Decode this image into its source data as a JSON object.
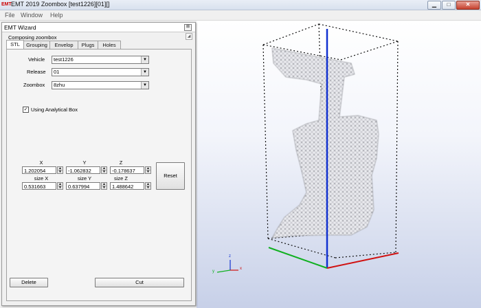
{
  "window": {
    "title": "EMT 2019 Zoombox [test1226][01][]",
    "app_icon_text": "EMT",
    "minimize_glyph": "▁",
    "maximize_glyph": "□",
    "close_glyph": "✕"
  },
  "menu": {
    "items": [
      "File",
      "Window",
      "Help"
    ]
  },
  "wizard": {
    "title": "EMT Wizard",
    "close_glyph": "⊠",
    "grip_glyph": "◢",
    "group_label": "Composing zoombox",
    "tabs": [
      {
        "label": "STL",
        "active": true
      },
      {
        "label": "Grouping",
        "active": false
      },
      {
        "label": "Envelop",
        "active": false
      },
      {
        "label": "Plugs",
        "active": false
      },
      {
        "label": "Holes",
        "active": false
      }
    ],
    "fields": {
      "vehicle": {
        "label": "Vehicle",
        "value": "test1226"
      },
      "release": {
        "label": "Release",
        "value": "01"
      },
      "zoombox": {
        "label": "Zoombox",
        "value": "8zhu"
      }
    },
    "using_analytical_box": {
      "label": "Using Analytical Box",
      "checked": true,
      "check_glyph": "✓"
    },
    "coords": {
      "x_label": "X",
      "y_label": "Y",
      "z_label": "Z",
      "x": "1.202054",
      "y": "-1.062832",
      "z": "-0.178637",
      "size_x_label": "size X",
      "size_y_label": "size Y",
      "size_z_label": "size Z",
      "size_x": "0.531663",
      "size_y": "0.637994",
      "size_z": "1.488642"
    },
    "buttons": {
      "reset": "Reset",
      "delete": "Delete",
      "cut": "Cut"
    },
    "spinner_up": "▲",
    "spinner_down": "▼",
    "dropdown_arrow": "▼"
  },
  "viewport": {
    "axis_colors": {
      "x": "#d01010",
      "y": "#10b020",
      "z": "#1030d0"
    },
    "triad_labels": {
      "x": "x",
      "y": "y",
      "z": "z"
    },
    "mesh_color": "#a0a0a8"
  }
}
